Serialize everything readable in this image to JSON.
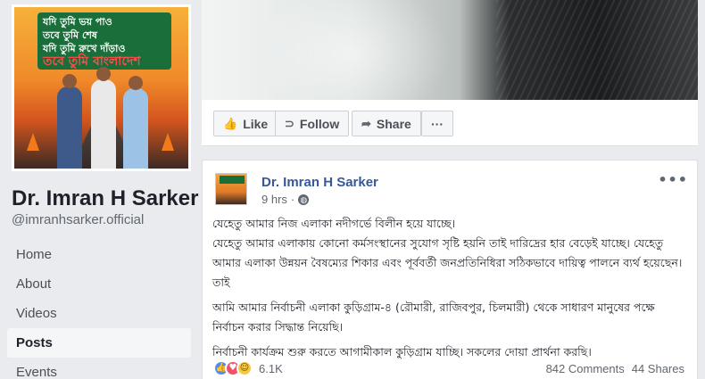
{
  "profile": {
    "name": "Dr. Imran H Sarker",
    "handle": "@imranhsarker.official",
    "picture_caption": {
      "line1": "যদি তুমি ভয় পাও",
      "line2": "তবে তুমি শেষ",
      "line3": "যদি তুমি রুখে দাঁড়াও",
      "line4": "তবে তুমি বাংলাদেশ"
    }
  },
  "sidebar": {
    "items": [
      {
        "label": "Home"
      },
      {
        "label": "About"
      },
      {
        "label": "Videos"
      },
      {
        "label": "Posts"
      },
      {
        "label": "Events"
      }
    ]
  },
  "actions": {
    "like": "Like",
    "follow": "Follow",
    "share": "Share",
    "more": "···"
  },
  "post": {
    "author": "Dr. Imran H Sarker",
    "time": "9 hrs",
    "menu": "•••",
    "paragraphs": [
      "যেহেতু আমার নিজ এলাকা নদীগর্ভে বিলীন হয়ে যাচ্ছে।\nযেহেতু আমার এলাকায় কোনো কর্মসংস্থানের সুযোগ সৃষ্টি হয়নি তাই দারিদ্রের হার বেড়েই যাচ্ছে। যেহেতু আমার এলাকা উন্নয়ন বৈষম্যের শিকার এবং পূর্ববর্তী জনপ্রতিনিধিরা সঠিকভাবে দায়িত্ব পালনে ব্যর্থ হয়েছেন। তাই",
      "আমি আমার নির্বাচনী এলাকা কুড়িগ্রাম-৪ (রৌমারী, রাজিবপুর, চিলমারী) থেকে সাধারণ মানুষের পক্ষে নির্বাচন করার সিদ্ধান্ত নিয়েছি।",
      "নির্বাচনী কার্যক্রম শুরু করতে আগামীকাল কুড়িগ্রাম যাচ্ছি। সকলের দোয়া প্রার্থনা করছি।"
    ],
    "reactions_count": "6.1K",
    "comments": "842 Comments",
    "shares": "44 Shares"
  }
}
